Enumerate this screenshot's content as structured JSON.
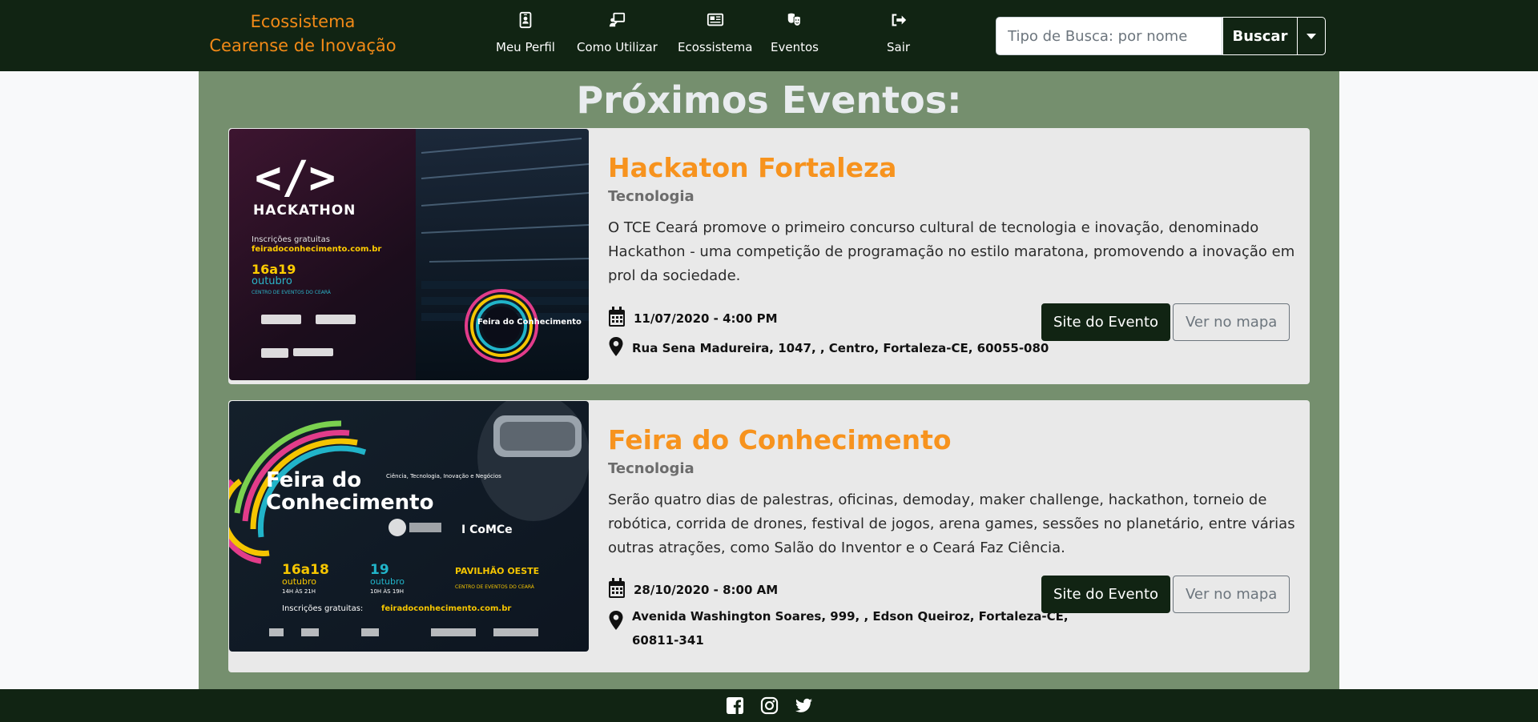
{
  "brand": {
    "line1": "Ecossistema",
    "line2": "Cearense de Inovação"
  },
  "nav": [
    {
      "label": "Meu Perfil",
      "icon": "id-badge-icon"
    },
    {
      "label": "Como Utilizar",
      "icon": "chalkboard-teacher-icon"
    },
    {
      "label": "Ecossistema",
      "icon": "newspaper-icon"
    },
    {
      "label": "Eventos",
      "icon": "theater-masks-icon"
    },
    {
      "label": "Sair",
      "icon": "sign-out-icon"
    }
  ],
  "search": {
    "placeholder": "Tipo de Busca: por nome",
    "button": "Buscar"
  },
  "page_title": "Próximos Eventos:",
  "events": [
    {
      "title": "Hackaton Fortaleza",
      "category": "Tecnologia",
      "description": "O TCE Ceará promove o primeiro concurso cultural de tecnologia e inovação, denominado Hackathon - uma competição de programação no estilo maratona, promovendo a inovação em prol da sociedade.",
      "datetime": "11/07/2020 - 4:00 PM",
      "address_line1": "Rua Sena Madureira, 1047, , Centro, Fortaleza-CE, 60055-080",
      "address_line2": "",
      "site_button": "Site do Evento",
      "map_button": "Ver no mapa",
      "image": {
        "code_symbol": "</>",
        "heading": "HACKATHON",
        "inscricoes": "Inscrições gratuitas",
        "site": "feiradoconhecimento.com.br",
        "dates": "16a19",
        "month": "outubro",
        "venue": "CENTRO DE EVENTOS DO CEARÁ",
        "logo_text": "Feira do Conhecimento"
      }
    },
    {
      "title": "Feira do Conhecimento",
      "category": "Tecnologia",
      "description": "Serão quatro dias de palestras, oficinas, demoday, maker challenge, hackathon, torneio de robótica, corrida de drones, festival de jogos, arena games, sessões no planetário, entre várias outras atrações, como Salão do Inventor e o Ceará Faz Ciência.",
      "datetime": "28/10/2020 - 8:00 AM",
      "address_line1": "Avenida Washington Soares, 999, , Edson Queiroz, Fortaleza-CE,",
      "address_line2": "60811-341",
      "site_button": "Site do Evento",
      "map_button": "Ver no mapa",
      "image": {
        "title1": "Feira do",
        "title2": "Conhecimento",
        "subtitle": "Ciência, Tecnologia, Inovação e Negócios",
        "d1": "16a18",
        "d1m": "outubro",
        "d1h": "14H ÀS 21H",
        "d2": "19",
        "d2m": "outubro",
        "d2h": "10H ÀS 19H",
        "place": "PAVILHÃO OESTE",
        "place2": "CENTRO DE EVENTOS DO CEARÁ",
        "inscricoes": "Inscrições gratuitas:",
        "site": "feiradoconhecimento.com.br",
        "partner": "I CoMCe"
      }
    }
  ],
  "footer": {
    "icons": [
      "facebook-icon",
      "instagram-icon",
      "twitter-icon"
    ]
  },
  "colors": {
    "header": "#112413",
    "main_bg": "#758f6e",
    "accent": "#f7931e",
    "card_bg": "#e9e9e9"
  }
}
